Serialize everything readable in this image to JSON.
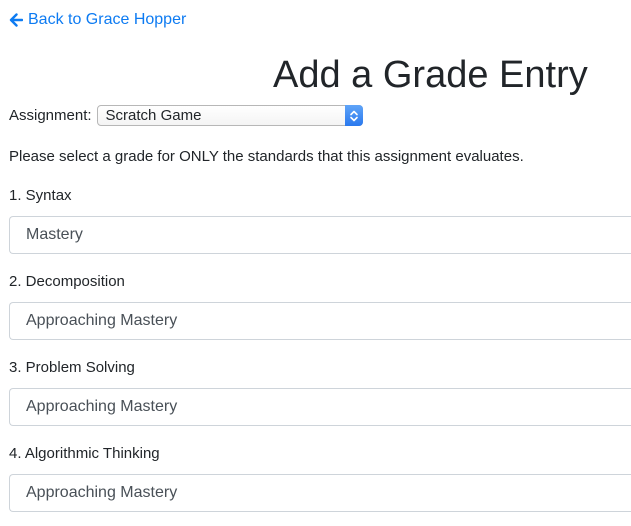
{
  "nav": {
    "back_label": "Back to Grace Hopper"
  },
  "page": {
    "title": "Add a Grade Entry"
  },
  "assignment": {
    "label": "Assignment:",
    "selected": "Scratch Game"
  },
  "instructions": "Please select a grade for ONLY the standards that this assignment evaluates.",
  "standards": [
    {
      "label": "1. Syntax",
      "grade": "Mastery"
    },
    {
      "label": "2. Decomposition",
      "grade": "Approaching Mastery"
    },
    {
      "label": "3. Problem Solving",
      "grade": "Approaching Mastery"
    },
    {
      "label": "4. Algorithmic Thinking",
      "grade": "Approaching Mastery"
    }
  ],
  "colors": {
    "link": "#0d7bf2",
    "text": "#212529",
    "select_text": "#495057",
    "select_border": "#ced4da",
    "stepper_accent": "#2a79ee"
  },
  "icons": {
    "back": "arrow-left-icon",
    "select_stepper": "chevron-updown-icon"
  }
}
